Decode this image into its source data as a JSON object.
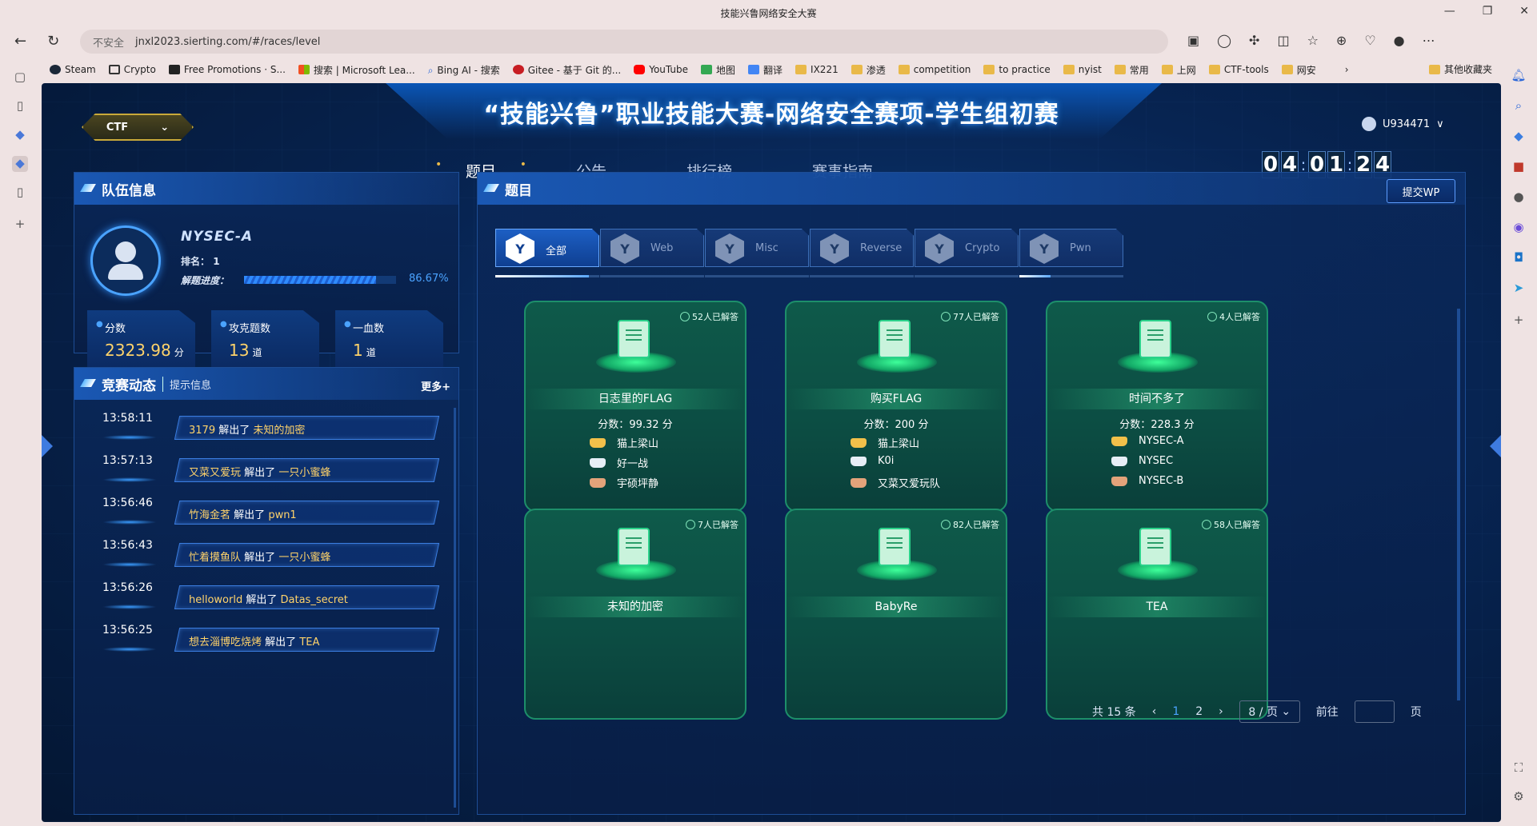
{
  "browser": {
    "tab_title": "技能兴鲁网络安全大赛",
    "insecure_label": "不安全",
    "url": "jnxl2023.sierting.com/#/races/level",
    "bookmarks": [
      {
        "label": "Steam",
        "color": "#1b2838"
      },
      {
        "label": "Crypto",
        "color": "#333333"
      },
      {
        "label": "Free Promotions · S...",
        "color": "#222222"
      },
      {
        "label": "搜索 | Microsoft Lea...",
        "color": "#f25022"
      },
      {
        "label": "Bing AI - 搜索",
        "color": "#2a66d8"
      },
      {
        "label": "Gitee - 基于 Git 的...",
        "color": "#c71d23"
      },
      {
        "label": "YouTube",
        "color": "#ff0000"
      },
      {
        "label": "地图",
        "color": "#34a853"
      },
      {
        "label": "翻译",
        "color": "#4285f4"
      },
      {
        "label": "IX221",
        "color": "#e9b949"
      },
      {
        "label": "渗透",
        "color": "#e9b949"
      },
      {
        "label": "competition",
        "color": "#e9b949"
      },
      {
        "label": "to practice",
        "color": "#e9b949"
      },
      {
        "label": "nyist",
        "color": "#e9b949"
      },
      {
        "label": "常用",
        "color": "#e9b949"
      },
      {
        "label": "上网",
        "color": "#e9b949"
      },
      {
        "label": "CTF-tools",
        "color": "#e9b949"
      },
      {
        "label": "网安",
        "color": "#e9b949"
      }
    ],
    "other_bookmarks": "其他收藏夹"
  },
  "header": {
    "title": "“技能兴鲁”职业技能大赛-网络安全赛项-学生组初赛",
    "mode": "CTF",
    "user": "U934471",
    "timer": [
      "0",
      "4",
      "0",
      "1",
      "2",
      "4"
    ],
    "nav": [
      "题目",
      "公告",
      "排行榜",
      "赛事指南"
    ]
  },
  "team": {
    "section_title": "队伍信息",
    "name": "NYSEC-A",
    "rank_label": "排名：",
    "rank": "1",
    "progress_label": "解题进度：",
    "progress_text": "86.67%",
    "progress_fraction": 0.8667,
    "stats": [
      {
        "label": "分数",
        "value": "2323.98",
        "unit": "分"
      },
      {
        "label": "攻克题数",
        "value": "13",
        "unit": "道"
      },
      {
        "label": "一血数",
        "value": "1",
        "unit": "道"
      }
    ]
  },
  "dynamics": {
    "title": "竞赛动态",
    "subtitle": "提示信息",
    "more": "更多+",
    "solved_word": "解出了",
    "items": [
      {
        "time": "13:58:11",
        "team": "3179",
        "task": "未知的加密"
      },
      {
        "time": "13:57:13",
        "team": "又菜又爱玩",
        "task": "一只小蜜蜂"
      },
      {
        "time": "13:56:46",
        "team": "竹海金茗",
        "task": "pwn1"
      },
      {
        "time": "13:56:43",
        "team": "忙着摸鱼队",
        "task": "一只小蜜蜂"
      },
      {
        "time": "13:56:26",
        "team": "helloworld",
        "task": "Datas_secret"
      },
      {
        "time": "13:56:25",
        "team": "想去淄博吃烧烤",
        "task": "TEA"
      }
    ]
  },
  "questions": {
    "title": "题目",
    "submit_wp": "提交WP",
    "categories": [
      "全部",
      "Web",
      "Misc",
      "Reverse",
      "Crypto",
      "Pwn"
    ],
    "category_progress": [
      0.9,
      0,
      0,
      0,
      0,
      0.3
    ],
    "score_prefix": "分数：",
    "score_suffix": "分",
    "cards": [
      {
        "solved": "52人已解答",
        "name": "日志里的FLAG",
        "score": "99.32",
        "winners": [
          "猫上梁山",
          "好一战",
          "宇硕坪静"
        ]
      },
      {
        "solved": "77人已解答",
        "name": "购买FLAG",
        "score": "200",
        "winners": [
          "猫上梁山",
          "K0i",
          "又菜又爱玩队"
        ]
      },
      {
        "solved": "4人已解答",
        "name": "时间不多了",
        "score": "228.3",
        "winners": [
          "NYSEC-A",
          "NYSEC",
          "NYSEC-B"
        ]
      },
      {
        "solved": "7人已解答",
        "name": "未知的加密"
      },
      {
        "solved": "82人已解答",
        "name": "BabyRe"
      },
      {
        "solved": "58人已解答",
        "name": "TEA"
      }
    ],
    "pager": {
      "total": "共 15 条",
      "pages": [
        "1",
        "2"
      ],
      "page_size": "8 / 页",
      "goto": "前往",
      "page_word": "页"
    }
  }
}
